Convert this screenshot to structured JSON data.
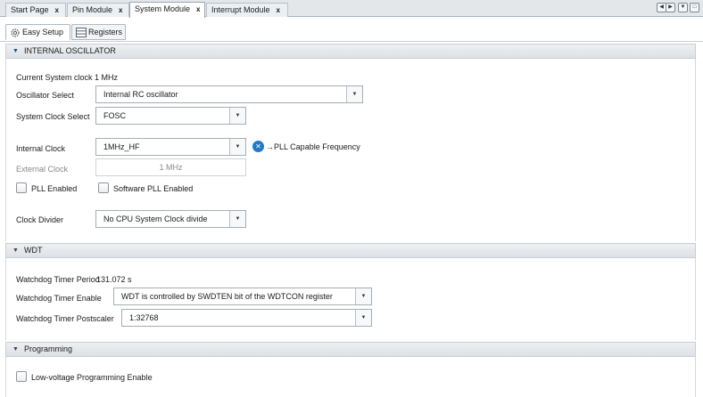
{
  "tabs": [
    {
      "label": "Start Page",
      "close": "x"
    },
    {
      "label": "Pin Module",
      "close": "x"
    },
    {
      "label": "System Module",
      "close": "x"
    },
    {
      "label": "Interrupt Module",
      "close": "x"
    }
  ],
  "subtabs": [
    {
      "label": "Easy Setup",
      "icon": "gear-icon"
    },
    {
      "label": "Registers",
      "icon": "table-icon"
    }
  ],
  "internal_oscillator": {
    "title": "INTERNAL OSCILLATOR",
    "current_clock_label": "Current System clock",
    "current_clock_value": "1 MHz",
    "oscillator_select_label": "Oscillator Select",
    "oscillator_select_value": "Internal RC oscillator",
    "system_clock_select_label": "System Clock Select",
    "system_clock_select_value": "FOSC",
    "internal_clock_label": "Internal Clock",
    "internal_clock_value": "1MHz_HF",
    "pll_note": "→PLL Capable Frequency",
    "external_clock_label": "External Clock",
    "external_clock_value": "1 MHz",
    "pll_enabled_label": "PLL Enabled",
    "software_pll_label": "Software PLL Enabled",
    "clock_divider_label": "Clock Divider",
    "clock_divider_value": "No CPU System Clock divide"
  },
  "wdt": {
    "title": "WDT",
    "period_label": "Watchdog Timer Period",
    "period_value": "131.072 s",
    "enable_label": "Watchdog Timer Enable",
    "enable_value": "WDT is controlled by SWDTEN bit of the WDTCON register",
    "postscaler_label": "Watchdog Timer Postscaler",
    "postscaler_value": "1:32768"
  },
  "programming": {
    "title": "Programming",
    "low_voltage_label": "Low-voltage Programming Enable"
  },
  "colors": {
    "section_accent": "#1f4e86",
    "info_icon": "#1f7ac7"
  }
}
